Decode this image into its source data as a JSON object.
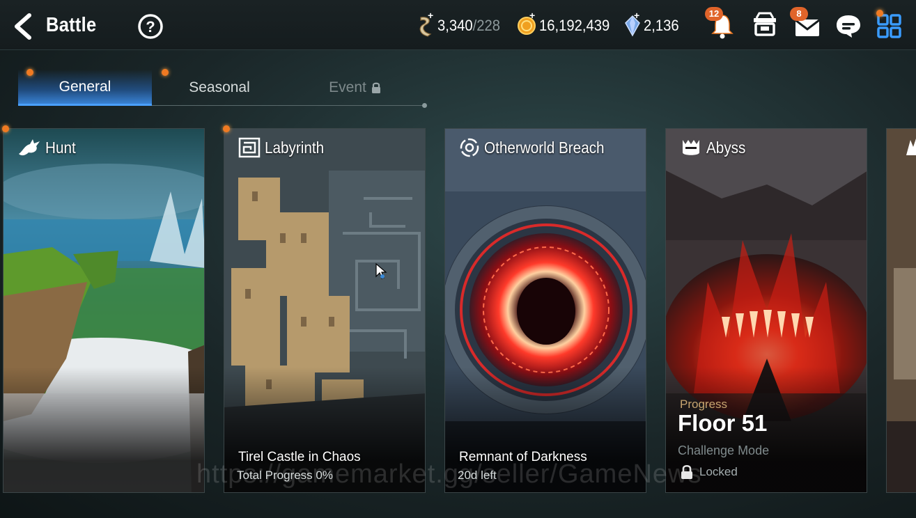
{
  "header": {
    "title": "Battle",
    "currencies": [
      {
        "icon": "stamina-icon",
        "value": "3,340",
        "max": "/228"
      },
      {
        "icon": "gold-icon",
        "value": "16,192,439"
      },
      {
        "icon": "crystal-icon",
        "value": "2,136"
      }
    ],
    "notifications": {
      "bell_count": "12",
      "mail_count": "8"
    }
  },
  "tabs": [
    {
      "label": "General",
      "active": true
    },
    {
      "label": "Seasonal",
      "active": false
    },
    {
      "label": "Event",
      "locked": true
    }
  ],
  "cards": [
    {
      "name": "Hunt",
      "icon": "dragon-icon"
    },
    {
      "name": "Labyrinth",
      "icon": "maze-icon",
      "subtitle": "Tirel Castle in Chaos",
      "info": "Total Progress 0%"
    },
    {
      "name": "Otherworld Breach",
      "icon": "portal-icon",
      "subtitle": "Remnant of Darkness",
      "info": "20d left"
    },
    {
      "name": "Abyss",
      "icon": "abyss-icon",
      "progress_label": "Progress",
      "floor": "Floor 51",
      "mode": "Challenge Mode",
      "status": "Locked"
    }
  ],
  "watermark": "https://gamemarket.gg/seller/GameNews",
  "colors": {
    "accent": "#4aa0ff",
    "badge": "#e0642a",
    "progress_gold": "#c7a570"
  }
}
